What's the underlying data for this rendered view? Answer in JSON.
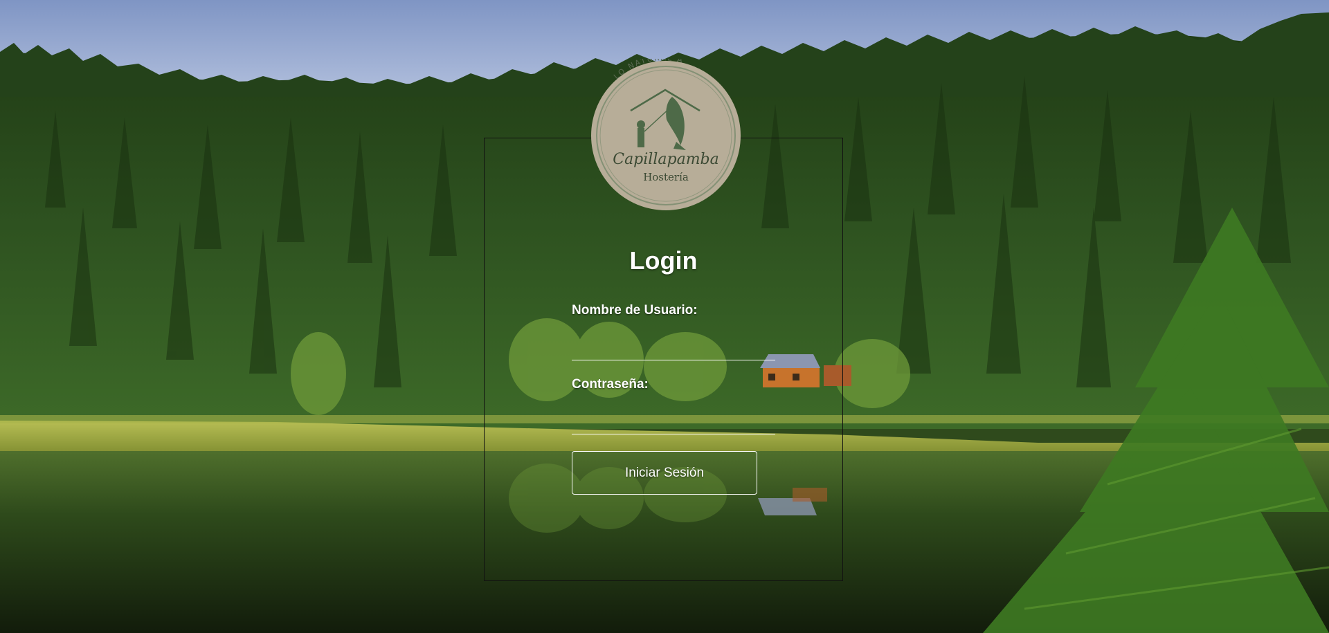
{
  "logo": {
    "arc_text": "LO NATURAL A",
    "brand_name": "Capillapamba",
    "brand_subtitle": "Hostería",
    "colors": {
      "badge": "#b7ad98",
      "ink": "#4e6a48"
    }
  },
  "login": {
    "title": "Login",
    "username_label": "Nombre de Usuario:",
    "username_value": "",
    "password_label": "Contraseña:",
    "password_value": "",
    "submit_label": "Iniciar Sesión"
  },
  "background": {
    "description_icon": "forest-lake-photo",
    "colors": {
      "sky": "#9fb2d6",
      "forest": "#2e4d1e",
      "meadow": "#a8b548",
      "water": "#1f2e14"
    }
  }
}
